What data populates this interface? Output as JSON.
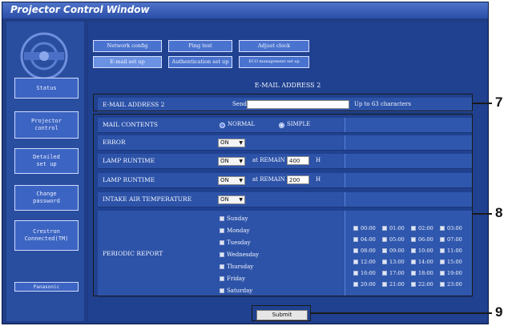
{
  "window": {
    "title": "Projector Control Window"
  },
  "sidebar": {
    "items": [
      {
        "label": "Status"
      },
      {
        "label": "Projector control"
      },
      {
        "label": "Detailed set up"
      },
      {
        "label": "Change password"
      },
      {
        "label": "Crestron Connected(TM)"
      },
      {
        "label": "Panasonic"
      }
    ]
  },
  "tabs": {
    "row1": [
      "Network config",
      "Ping test",
      "Adjust clock"
    ],
    "row2": [
      "E-mail set up",
      "Authentication set up",
      "ECO management set up"
    ]
  },
  "page": {
    "heading": "E-MAIL ADDRESS 2"
  },
  "email": {
    "label": "E-MAIL ADDRESS 2",
    "send_to": "Send to",
    "value": "",
    "hint": "Up to 63 characters"
  },
  "contents": {
    "label": "MAIL CONTENTS",
    "normal": "NORMAL",
    "simple": "SIMPLE"
  },
  "error": {
    "label": "ERROR",
    "value": "ON"
  },
  "lamp1": {
    "label": "LAMP RUNTIME",
    "value": "ON",
    "at_remain": "at REMAIN",
    "hours": "400",
    "unit": "H"
  },
  "lamp2": {
    "label": "LAMP RUNTIME",
    "value": "ON",
    "at_remain": "at REMAIN",
    "hours": "200",
    "unit": "H"
  },
  "intake": {
    "label": "INTAKE AIR TEMPERATURE",
    "value": "ON"
  },
  "periodic": {
    "label": "PERIODIC REPORT",
    "days": [
      "Sunday",
      "Monday",
      "Tuesday",
      "Wednesday",
      "Thursday",
      "Friday",
      "Saturday"
    ],
    "hours": [
      "00:00",
      "01:00",
      "02:00",
      "03:00",
      "04:00",
      "05:00",
      "06:00",
      "07:00",
      "08:00",
      "09:00",
      "10:00",
      "11:00",
      "12:00",
      "13:00",
      "14:00",
      "15:00",
      "16:00",
      "17:00",
      "18:00",
      "19:00",
      "20:00",
      "21:00",
      "22:00",
      "23:00"
    ]
  },
  "actions": {
    "submit": "Submit"
  },
  "callouts": {
    "c7": "7",
    "c8": "8",
    "c9": "9"
  }
}
